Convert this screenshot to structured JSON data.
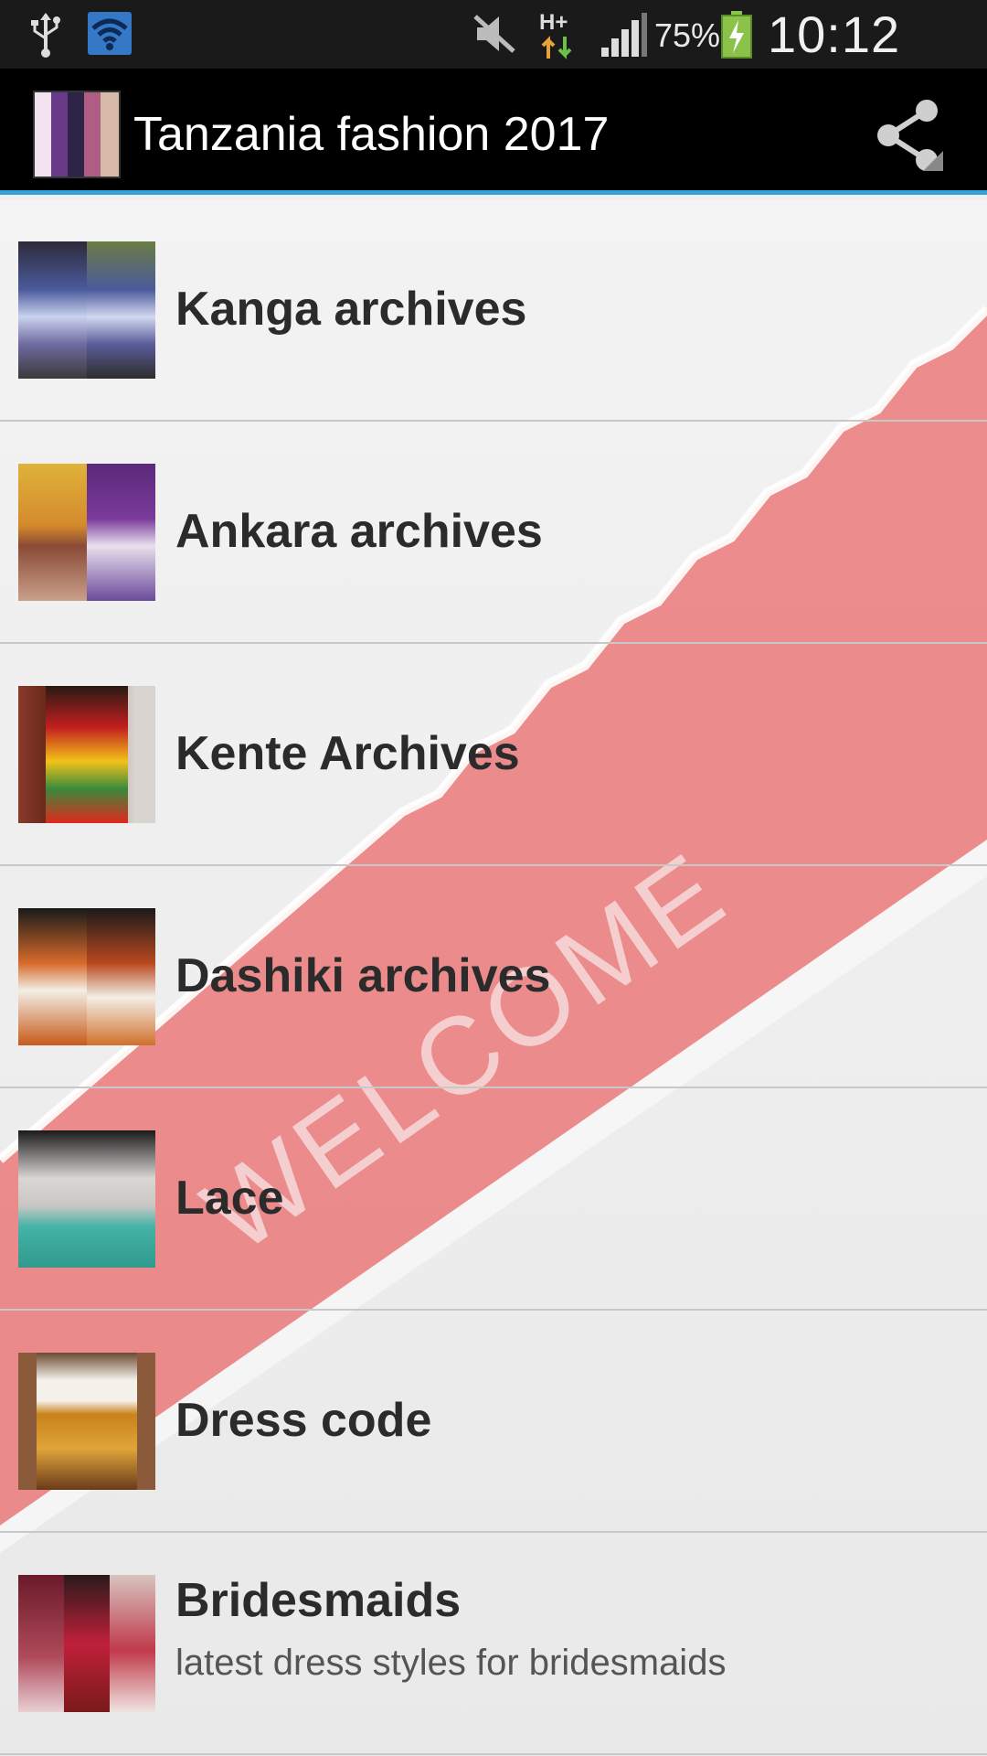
{
  "status_bar": {
    "battery_percent": "75%",
    "time": "10:12 AM",
    "net_label": "H+",
    "icons": [
      "usb-icon",
      "wifi-icon",
      "mute-icon",
      "network-type-icon",
      "signal-icon",
      "battery-charging-icon"
    ]
  },
  "action_bar": {
    "title": "Tanzania fashion 2017",
    "share_icon": "share-icon",
    "accent_color": "#33a2d8"
  },
  "list": {
    "items": [
      {
        "label": "Kanga archives",
        "subtitle": ""
      },
      {
        "label": "Ankara archives",
        "subtitle": ""
      },
      {
        "label": "Kente Archives",
        "subtitle": ""
      },
      {
        "label": "Dashiki archives",
        "subtitle": ""
      },
      {
        "label": "Lace",
        "subtitle": ""
      },
      {
        "label": "Dress code",
        "subtitle": ""
      },
      {
        "label": "Bridesmaids",
        "subtitle": "latest dress styles for bridesmaids"
      }
    ]
  },
  "background": {
    "welcome_text": "WELCOME",
    "carpet_color": "#e85a5a"
  }
}
